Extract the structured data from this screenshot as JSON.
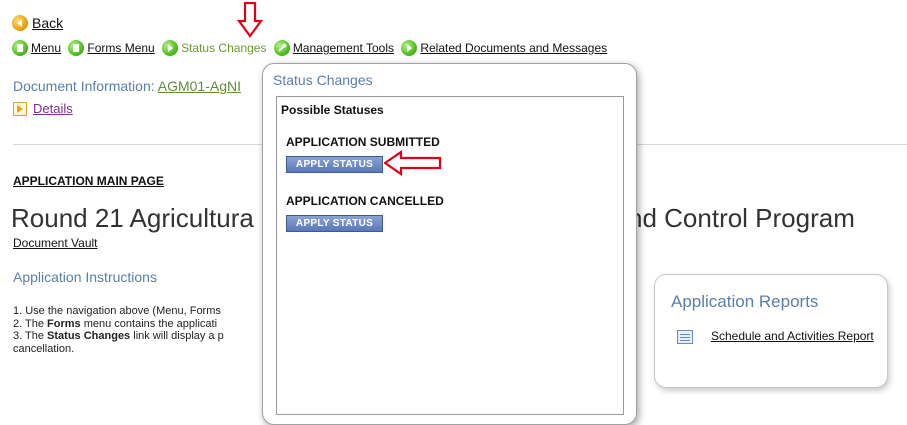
{
  "back_link": {
    "label": "Back"
  },
  "nav": {
    "items": [
      {
        "label": "Menu"
      },
      {
        "label": "Forms Menu"
      },
      {
        "label": "Status Changes"
      },
      {
        "label": "Management Tools"
      },
      {
        "label": "Related Documents and Messages"
      }
    ]
  },
  "document_info": {
    "label": "Document Information:",
    "id_visible": "AGM01-AgNI"
  },
  "details_link": {
    "label": "Details"
  },
  "page": {
    "main_heading": "APPLICATION MAIN PAGE",
    "title_left": "Round 21 Agricultura",
    "title_right": "nd Control Program",
    "vault_link": "Document Vault",
    "instructions_heading": "Application Instructions",
    "instructions": [
      {
        "prefix": "1. Use the navigation above (Menu, Forms",
        "bold": "",
        "suffix": ""
      },
      {
        "prefix": "2. The ",
        "bold": "Forms",
        "suffix": " menu contains the applicati"
      },
      {
        "prefix": "3. The ",
        "bold": "Status Changes",
        "suffix": " link will display a p"
      },
      {
        "prefix": "cancellation.",
        "bold": "",
        "suffix": ""
      }
    ]
  },
  "reports": {
    "title": "Application Reports",
    "links": [
      {
        "label": "Schedule and Activities Report"
      }
    ]
  },
  "status_popup": {
    "title": "Status Changes",
    "possible_label": "Possible Statuses",
    "statuses": [
      {
        "name": "APPLICATION SUBMITTED",
        "button": "APPLY STATUS"
      },
      {
        "name": "APPLICATION CANCELLED",
        "button": "APPLY STATUS"
      }
    ]
  },
  "colors": {
    "accent_blue_text": "#5a7fa8",
    "nav_current": "#6a9a2f",
    "button_blue": "#5a78b8",
    "annotation_red": "#e0001b"
  }
}
